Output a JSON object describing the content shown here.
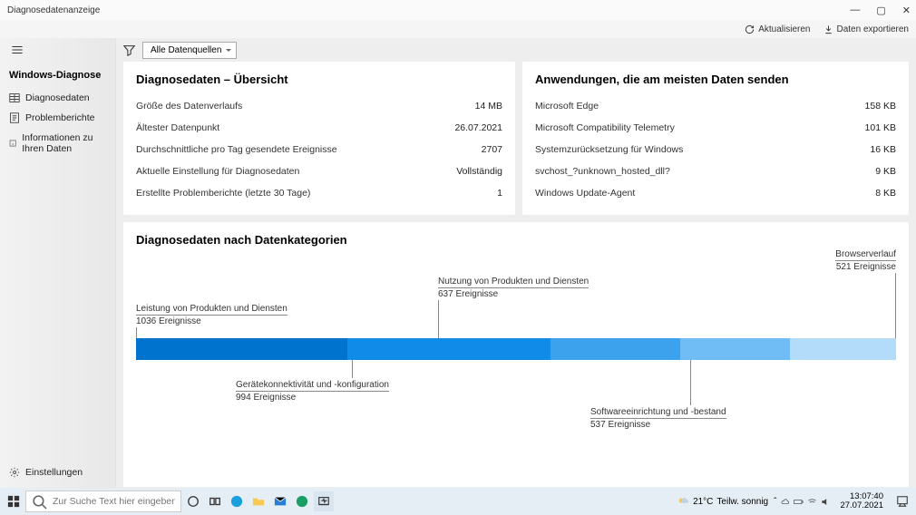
{
  "titlebar": {
    "title": "Diagnosedatenanzeige"
  },
  "appbar": {
    "refresh": "Aktualisieren",
    "export": "Daten exportieren"
  },
  "sidebar": {
    "heading": "Windows-Diagnose",
    "items": [
      {
        "label": "Diagnosedaten"
      },
      {
        "label": "Problemberichte"
      },
      {
        "label": "Informationen zu Ihren Daten"
      }
    ],
    "settings": "Einstellungen"
  },
  "filter": {
    "dropdown": "Alle Datenquellen"
  },
  "overview": {
    "title": "Diagnosedaten – Übersicht",
    "rows": [
      {
        "k": "Größe des Datenverlaufs",
        "v": "14 MB"
      },
      {
        "k": "Ältester Datenpunkt",
        "v": "26.07.2021"
      },
      {
        "k": "Durchschnittliche pro Tag gesendete Ereignisse",
        "v": "2707"
      },
      {
        "k": "Aktuelle Einstellung für Diagnosedaten",
        "v": "Vollständig"
      },
      {
        "k": "Erstellte Problemberichte (letzte 30 Tage)",
        "v": "1"
      }
    ]
  },
  "apps": {
    "title": "Anwendungen, die am meisten Daten senden",
    "rows": [
      {
        "k": "Microsoft Edge",
        "v": "158 KB"
      },
      {
        "k": "Microsoft Compatibility Telemetry",
        "v": "101 KB"
      },
      {
        "k": "Systemzurücksetzung für Windows",
        "v": "16 KB"
      },
      {
        "k": "svchost_?unknown_hosted_dll?",
        "v": "9 KB"
      },
      {
        "k": "Windows Update-Agent",
        "v": "8 KB"
      }
    ]
  },
  "categories_title": "Diagnosedaten nach Datenkategorien",
  "chart_data": {
    "type": "bar",
    "orientation": "stacked-horizontal",
    "unit": "Ereignisse",
    "series": [
      {
        "name": "Leistung von Produkten und Diensten",
        "value": 1036,
        "color": "#0073cf"
      },
      {
        "name": "Gerätekonnektivität und -konfiguration",
        "value": 994,
        "color": "#118be8"
      },
      {
        "name": "Nutzung von Produkten und Diensten",
        "value": 637,
        "color": "#3da2ee"
      },
      {
        "name": "Softwareeinrichtung und -bestand",
        "value": 537,
        "color": "#6fbdf4"
      },
      {
        "name": "Browserverlauf",
        "value": 521,
        "color": "#b3dcfa"
      }
    ],
    "total": 3725
  },
  "taskbar": {
    "search_placeholder": "Zur Suche Text hier eingeben",
    "weather_temp": "21°C",
    "weather_desc": "Teilw. sonnig",
    "time": "13:07:40",
    "date": "27.07.2021"
  }
}
